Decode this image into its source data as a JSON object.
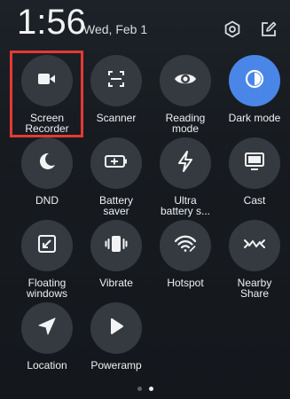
{
  "status": {
    "time": "1:56",
    "date": "Wed, Feb 1"
  },
  "header_icons": [
    "settings-icon",
    "edit-icon"
  ],
  "tiles": [
    {
      "label": "Screen\nRecorder",
      "icon": "video-camera-icon",
      "active": false
    },
    {
      "label": "Scanner",
      "icon": "scan-icon",
      "active": false
    },
    {
      "label": "Reading\nmode",
      "icon": "eye-icon",
      "active": false
    },
    {
      "label": "Dark mode",
      "icon": "dark-mode-icon",
      "active": true
    },
    {
      "label": "DND",
      "icon": "moon-icon",
      "active": false
    },
    {
      "label": "Battery\nsaver",
      "icon": "battery-icon",
      "active": false
    },
    {
      "label": "Ultra\nbattery s...",
      "icon": "lightning-icon",
      "active": false
    },
    {
      "label": "Cast",
      "icon": "cast-icon",
      "active": false
    },
    {
      "label": "Floating\nwindows",
      "icon": "floating-window-icon",
      "active": false
    },
    {
      "label": "Vibrate",
      "icon": "vibrate-icon",
      "active": false
    },
    {
      "label": "Hotspot",
      "icon": "hotspot-icon",
      "active": false
    },
    {
      "label": "Nearby\nShare",
      "icon": "nearby-share-icon",
      "active": false
    },
    {
      "label": "Location",
      "icon": "location-icon",
      "active": false
    },
    {
      "label": "Poweramp",
      "icon": "play-icon",
      "active": false
    }
  ],
  "pager": {
    "pages": 2,
    "current": 2
  },
  "colors": {
    "background": "#171b20",
    "tile": "#353a40",
    "active_tile": "#4a86e8",
    "highlight": "#e53935"
  }
}
